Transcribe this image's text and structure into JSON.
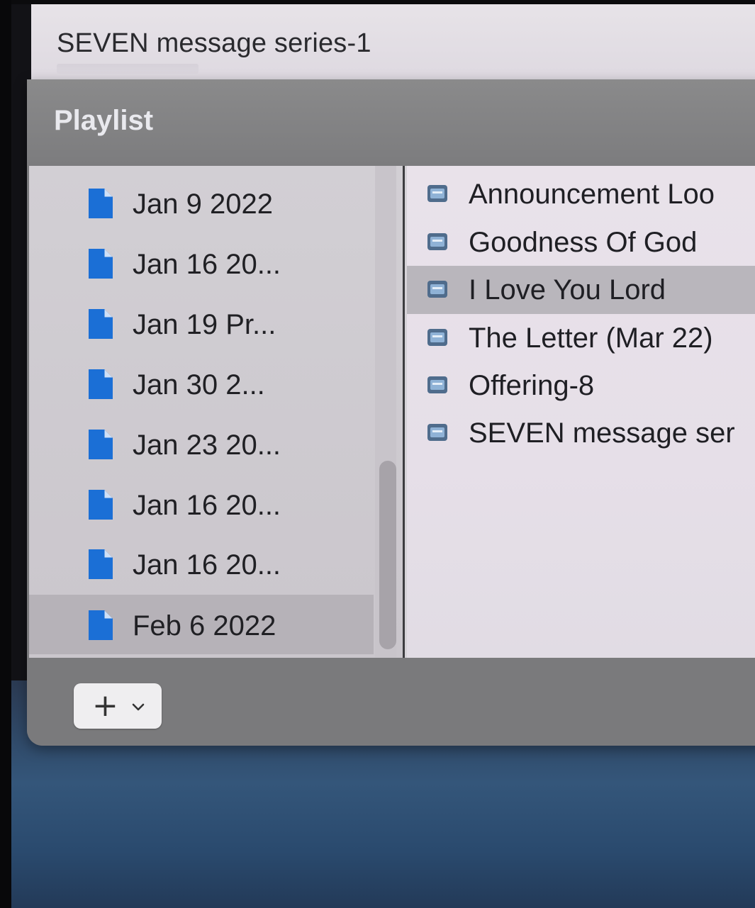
{
  "background_window": {
    "title": "SEVEN message series-1"
  },
  "playlist": {
    "title": "Playlist",
    "left_items": [
      {
        "label": "Jan 9 2022",
        "icon": "document-icon",
        "selected": false
      },
      {
        "label": "Jan 16 20...",
        "icon": "document-icon",
        "selected": false
      },
      {
        "label": "Jan 19 Pr...",
        "icon": "document-icon",
        "selected": false
      },
      {
        "label": "Jan 30 2...",
        "icon": "document-icon",
        "selected": false
      },
      {
        "label": "Jan 23 20...",
        "icon": "document-icon",
        "selected": false
      },
      {
        "label": "Jan 16 20...",
        "icon": "document-icon",
        "selected": false
      },
      {
        "label": "Jan 16 20...",
        "icon": "document-icon",
        "selected": false
      },
      {
        "label": "Feb 6 2022",
        "icon": "document-icon",
        "selected": true
      }
    ],
    "right_items": [
      {
        "label": "Announcement Loo",
        "icon": "presentation-icon",
        "selected": false
      },
      {
        "label": "Goodness Of God",
        "icon": "presentation-icon",
        "selected": false
      },
      {
        "label": "I Love You Lord",
        "icon": "presentation-icon",
        "selected": true
      },
      {
        "label": "The Letter (Mar 22)",
        "icon": "presentation-icon",
        "selected": false
      },
      {
        "label": "Offering-8",
        "icon": "presentation-icon",
        "selected": false
      },
      {
        "label": "SEVEN message ser",
        "icon": "presentation-icon",
        "selected": false
      }
    ],
    "footer": {
      "add_button_icon": "plus-icon",
      "add_menu_icon": "chevron-down-icon"
    }
  },
  "colors": {
    "document_icon": "#1b6fd6",
    "selection": "#b6b2b8",
    "panel_header": "#7f7f81"
  }
}
